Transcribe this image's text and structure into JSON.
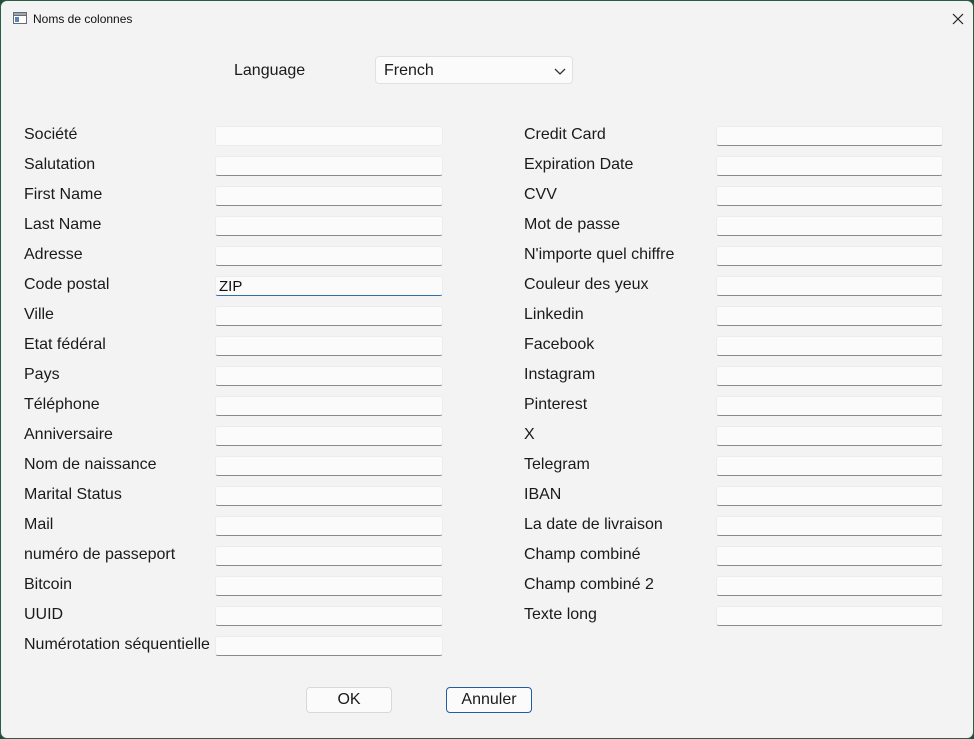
{
  "window": {
    "title": "Noms de colonnes"
  },
  "language": {
    "label": "Language",
    "selected": "French"
  },
  "left_fields": [
    {
      "label": "Société",
      "value": ""
    },
    {
      "label": "Salutation",
      "value": ""
    },
    {
      "label": "First Name",
      "value": ""
    },
    {
      "label": "Last Name",
      "value": ""
    },
    {
      "label": "Adresse",
      "value": ""
    },
    {
      "label": "Code postal",
      "value": "ZIP"
    },
    {
      "label": "Ville",
      "value": ""
    },
    {
      "label": "Etat fédéral",
      "value": ""
    },
    {
      "label": "Pays",
      "value": ""
    },
    {
      "label": "Téléphone",
      "value": ""
    },
    {
      "label": "Anniversaire",
      "value": ""
    },
    {
      "label": "Nom de naissance",
      "value": ""
    },
    {
      "label": "Marital Status",
      "value": ""
    },
    {
      "label": "Mail",
      "value": ""
    },
    {
      "label": "numéro de passeport",
      "value": ""
    },
    {
      "label": "Bitcoin",
      "value": ""
    },
    {
      "label": "UUID",
      "value": ""
    },
    {
      "label": "Numérotation séquentielle",
      "value": ""
    }
  ],
  "right_fields": [
    {
      "label": "Credit Card",
      "value": ""
    },
    {
      "label": "Expiration Date",
      "value": ""
    },
    {
      "label": "CVV",
      "value": ""
    },
    {
      "label": "Mot de passe",
      "value": ""
    },
    {
      "label": "N'importe quel chiffre",
      "value": ""
    },
    {
      "label": "Couleur des yeux",
      "value": ""
    },
    {
      "label": "Linkedin",
      "value": ""
    },
    {
      "label": "Facebook",
      "value": ""
    },
    {
      "label": "Instagram",
      "value": ""
    },
    {
      "label": "Pinterest",
      "value": ""
    },
    {
      "label": "X",
      "value": ""
    },
    {
      "label": "Telegram",
      "value": ""
    },
    {
      "label": "IBAN",
      "value": ""
    },
    {
      "label": "La date de livraison",
      "value": ""
    },
    {
      "label": "Champ combiné",
      "value": ""
    },
    {
      "label": "Champ combiné 2",
      "value": ""
    },
    {
      "label": "Texte long",
      "value": ""
    }
  ],
  "buttons": {
    "ok": "OK",
    "cancel": "Annuler"
  },
  "icons": {
    "app": "window-app-icon",
    "close": "close-icon",
    "dropdown": "chevron-down-icon"
  },
  "colors": {
    "focus_accent": "#2f6fab",
    "default_button_border": "#1f5fa0",
    "desktop_background": "#1f4f3a"
  }
}
